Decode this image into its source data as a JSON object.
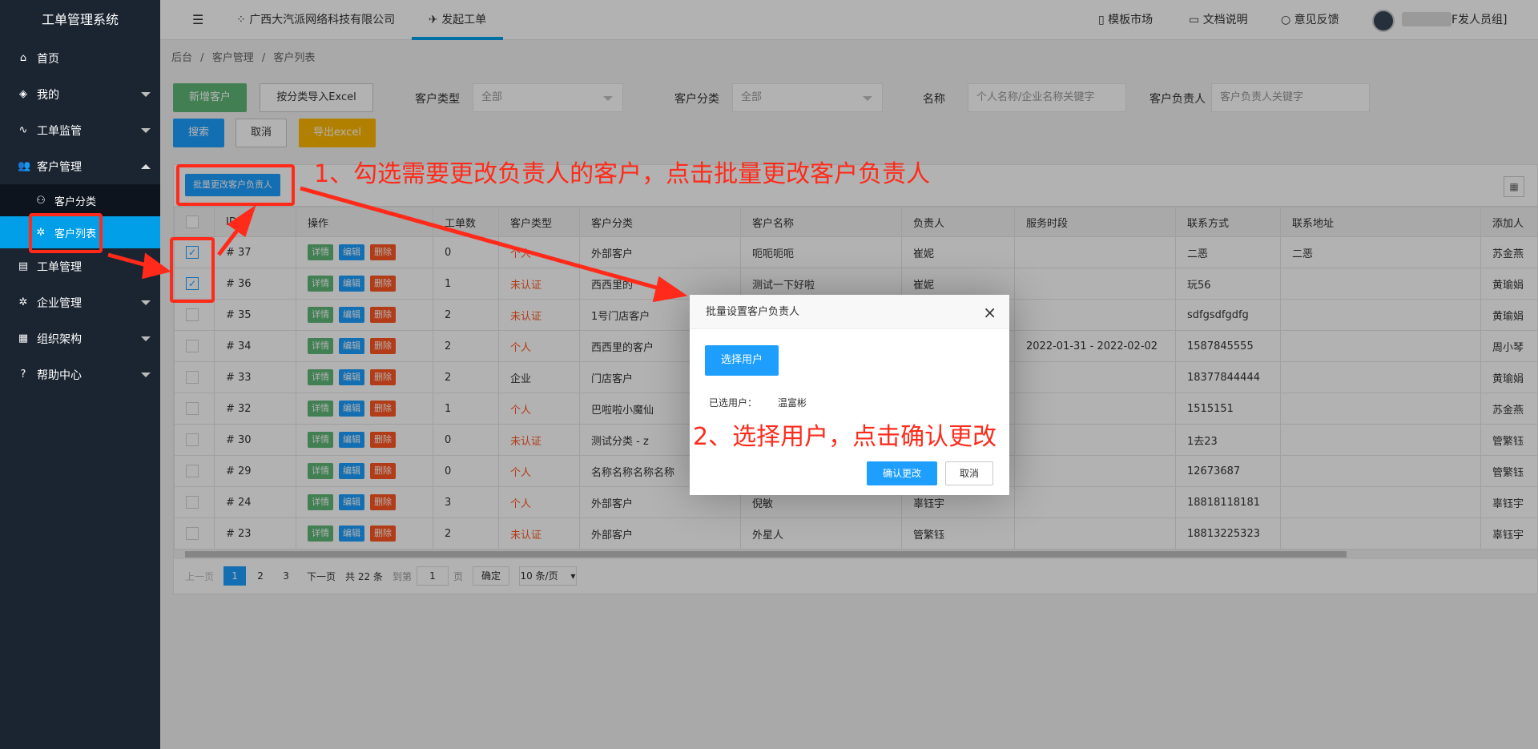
{
  "app": {
    "title": "工单管理系统"
  },
  "sidebar": {
    "items": [
      {
        "label": "首页",
        "icon": "home-icon"
      },
      {
        "label": "我的",
        "icon": "layers-icon"
      },
      {
        "label": "工单监管",
        "icon": "pulse-icon"
      },
      {
        "label": "客户管理",
        "icon": "users-icon"
      },
      {
        "label": "客户分类",
        "icon": "user-icon"
      },
      {
        "label": "客户列表",
        "icon": "gear-icon"
      },
      {
        "label": "工单管理",
        "icon": "clipboard-icon"
      },
      {
        "label": "企业管理",
        "icon": "gear-icon"
      },
      {
        "label": "组织架构",
        "icon": "org-icon"
      },
      {
        "label": "帮助中心",
        "icon": "question-icon"
      }
    ]
  },
  "topbar": {
    "menu_icon": "☰",
    "company": "广西大汽派网络科技有限公司",
    "create": "发起工单",
    "template": "模板市场",
    "docs": "文档说明",
    "feedback": "意见反馈",
    "user": "F发人员组]"
  },
  "breadcrumb": {
    "home": "后台",
    "sep": "/",
    "mid": "客户管理",
    "current": "客户列表"
  },
  "filters": {
    "add_button": "新增客户",
    "import_button": "按分类导入Excel",
    "type_label": "客户类型",
    "type_value": "全部",
    "cat_label": "客户分类",
    "cat_value": "全部",
    "name_label": "名称",
    "name_placeholder": "个人名称/企业名称关键字",
    "owner_label": "客户负责人",
    "owner_placeholder": "客户负责人关键字",
    "search_button": "搜索",
    "cancel_button": "取消",
    "export_button": "导出excel"
  },
  "toolbar": {
    "batch_button": "批量更改客户负责人"
  },
  "table": {
    "columns": [
      "ID",
      "操作",
      "工单数",
      "客户类型",
      "客户分类",
      "客户名称",
      "负责人",
      "服务时段",
      "联系方式",
      "联系地址",
      "添加人"
    ],
    "actions": {
      "detail": "详情",
      "edit": "编辑",
      "delete": "删除"
    },
    "rows": [
      {
        "checked": true,
        "id": "# 37",
        "count": "0",
        "type": "个人",
        "cat": "外部客户",
        "name": "呃呃呃呃",
        "owner": "崔妮",
        "period": "",
        "contact": "二恶",
        "addr": "二恶",
        "adder": "苏金燕"
      },
      {
        "checked": true,
        "id": "# 36",
        "count": "1",
        "type": "未认证",
        "cat": "西西里的",
        "name": "测试一下好啦",
        "owner": "崔妮",
        "period": "",
        "contact": "玩56",
        "addr": "",
        "adder": "黄瑜娟"
      },
      {
        "checked": false,
        "id": "# 35",
        "count": "2",
        "type": "未认证",
        "cat": "1号门店客户",
        "name": "",
        "owner": "",
        "period": "",
        "contact": "sdfgsdfgdfg",
        "addr": "",
        "adder": "黄瑜娟"
      },
      {
        "checked": false,
        "id": "# 34",
        "count": "2",
        "type": "个人",
        "cat": "西西里的客户",
        "name": "",
        "owner": "",
        "period": "2022-01-31 - 2022-02-02",
        "contact": "1587845555",
        "addr": "",
        "adder": "周小琴"
      },
      {
        "checked": false,
        "id": "# 33",
        "count": "2",
        "type": "企业",
        "cat": "门店客户",
        "name": "",
        "owner": "",
        "period": "",
        "contact": "18377844444",
        "addr": "",
        "adder": "黄瑜娟"
      },
      {
        "checked": false,
        "id": "# 32",
        "count": "1",
        "type": "个人",
        "cat": "巴啦啦小魔仙",
        "name": "",
        "owner": "",
        "period": "",
        "contact": "1515151",
        "addr": "",
        "adder": "苏金燕"
      },
      {
        "checked": false,
        "id": "# 30",
        "count": "0",
        "type": "未认证",
        "cat": "测试分类 - z",
        "name": "",
        "owner": "",
        "period": "",
        "contact": "1去23",
        "addr": "",
        "adder": "管繁钰"
      },
      {
        "checked": false,
        "id": "# 29",
        "count": "0",
        "type": "个人",
        "cat": "名称名称名称名称",
        "name": "",
        "owner": "",
        "period": "",
        "contact": "12673687",
        "addr": "",
        "adder": "管繁钰"
      },
      {
        "checked": false,
        "id": "# 24",
        "count": "3",
        "type": "个人",
        "cat": "外部客户",
        "name": "倪敏",
        "owner": "辜钰宇",
        "period": "",
        "contact": "18818118181",
        "addr": "",
        "adder": "辜钰宇"
      },
      {
        "checked": false,
        "id": "# 23",
        "count": "2",
        "type": "未认证",
        "cat": "外部客户",
        "name": "外星人",
        "owner": "管繁钰",
        "period": "",
        "contact": "18813225323",
        "addr": "",
        "adder": "辜钰宇"
      }
    ]
  },
  "pager": {
    "prev": "上一页",
    "p1": "1",
    "p2": "2",
    "p3": "3",
    "next": "下一页",
    "total": "共 22 条",
    "goto": "到第",
    "page_input": "1",
    "page_unit": "页",
    "confirm": "确定",
    "size": "10 条/页"
  },
  "modal": {
    "title": "批量设置客户负责人",
    "close": "×",
    "select_button": "选择用户",
    "selected_label": "已选用户：",
    "selected_value": "温富彬",
    "confirm_button": "确认更改",
    "cancel_button": "取消"
  },
  "annotations": {
    "step1": "1、勾选需要更改负责人的客户，点击批量更改客户负责人",
    "step2": "2、选择用户，点击确认更改"
  },
  "colors": {
    "accent": "#1e9fff",
    "sidebar": "#1b2431",
    "annotation": "#ff2a1a",
    "green": "#5fb878",
    "danger": "#ff5722",
    "warning": "#ffb800"
  }
}
